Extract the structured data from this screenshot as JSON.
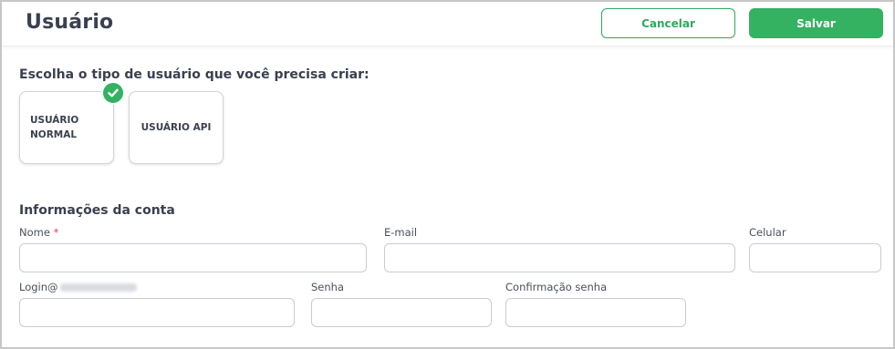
{
  "header": {
    "title": "Usuário",
    "cancel_label": "Cancelar",
    "save_label": "Salvar"
  },
  "user_type": {
    "prompt": "Escolha o tipo de usuário que você precisa criar:",
    "options": [
      {
        "line1": "USUÁRIO",
        "line2": "NORMAL",
        "selected": true
      },
      {
        "line1": "USUÁRIO API",
        "selected": false
      }
    ]
  },
  "account": {
    "heading": "Informações da conta",
    "fields": {
      "nome": {
        "label": "Nome",
        "required_mark": "*",
        "value": ""
      },
      "email": {
        "label": "E-mail",
        "value": ""
      },
      "celular": {
        "label": "Celular",
        "value": ""
      },
      "login": {
        "label": "Login@",
        "value": ""
      },
      "senha": {
        "label": "Senha",
        "value": ""
      },
      "confirmacao": {
        "label": "Confirmação senha",
        "value": ""
      }
    }
  },
  "colors": {
    "accent": "#34b262",
    "title_text": "#3b4050",
    "required": "#e04848"
  },
  "icons": {
    "selected_check": "check-circle-icon"
  }
}
